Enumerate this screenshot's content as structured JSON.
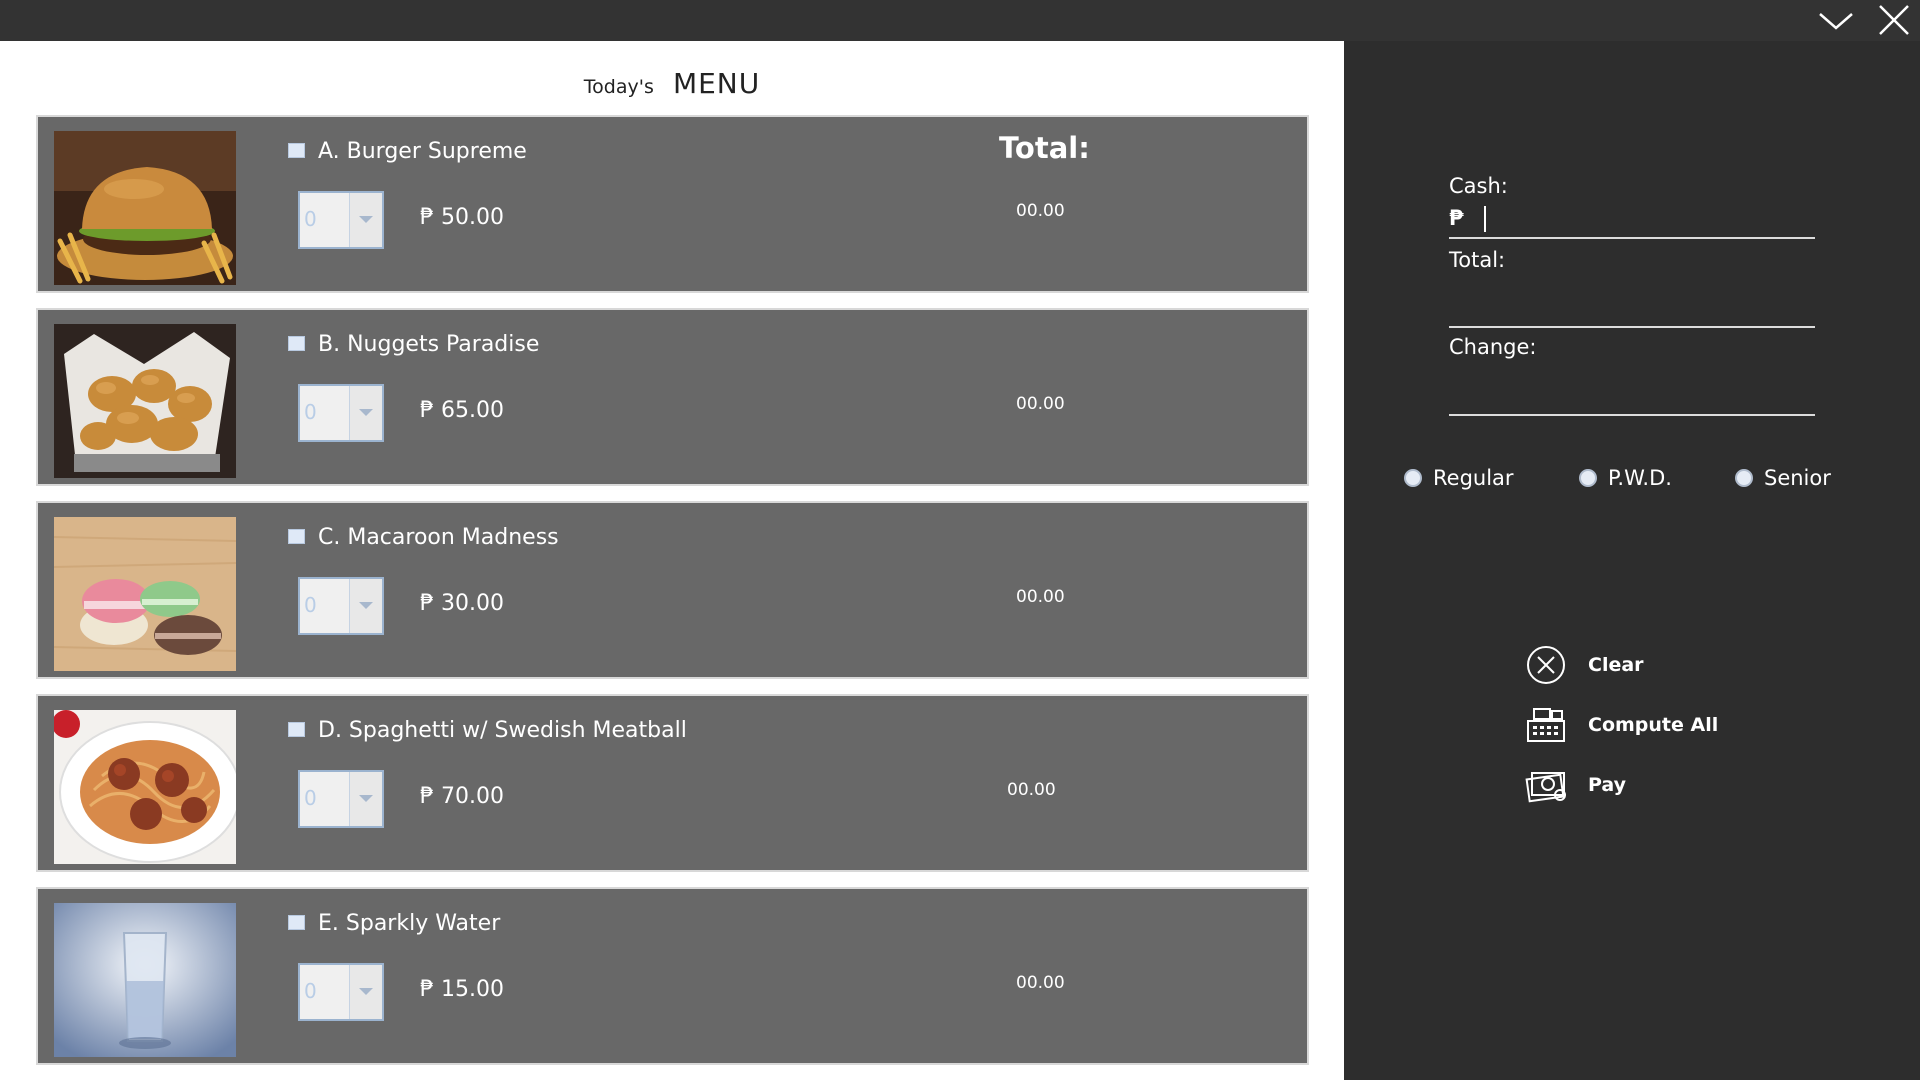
{
  "window": {
    "minimize_icon": "chevron-down-icon",
    "close_icon": "close-icon"
  },
  "menu": {
    "todays": "Today's",
    "title": "MENU",
    "total_header": "Total:",
    "items": [
      {
        "name": "A. Burger Supreme",
        "qty": "0",
        "price": "₱ 50.00",
        "total": "00.00",
        "image": "burger-image"
      },
      {
        "name": "B. Nuggets Paradise",
        "qty": "0",
        "price": "₱ 65.00",
        "total": "00.00",
        "image": "nuggets-image"
      },
      {
        "name": "C. Macaroon Madness",
        "qty": "0",
        "price": "₱ 30.00",
        "total": "00.00",
        "image": "macaroon-image"
      },
      {
        "name": "D. Spaghetti w/ Swedish Meatball",
        "qty": "0",
        "price": "₱ 70.00",
        "total": "00.00",
        "image": "spaghetti-image"
      },
      {
        "name": "E. Sparkly Water",
        "qty": "0",
        "price": "₱ 15.00",
        "total": "00.00",
        "image": "water-image"
      }
    ]
  },
  "payment": {
    "cash_label": "Cash:",
    "cash_prefix": "₱",
    "cash_value": "",
    "total_label": "Total:",
    "total_value": "",
    "change_label": "Change:",
    "change_value": "",
    "discount_options": [
      "Regular",
      "P.W.D.",
      "Senior"
    ]
  },
  "actions": {
    "clear": {
      "label": "Clear",
      "icon": "clear-x-icon"
    },
    "compute": {
      "label": "Compute All",
      "icon": "cash-register-icon"
    },
    "pay": {
      "label": "Pay",
      "icon": "money-icon"
    }
  },
  "colors": {
    "background": "#2d2d2d",
    "menu_panel": "#ffffff",
    "item_row": "#686868",
    "text": "#ffffff"
  }
}
